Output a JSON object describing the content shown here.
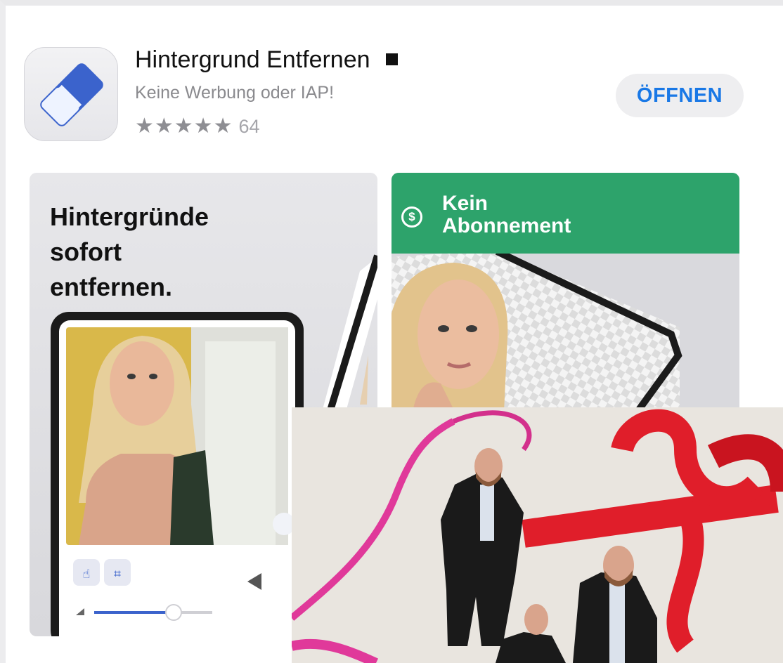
{
  "app": {
    "title": "Hintergrund Entfernen",
    "subtitle": "Keine Werbung oder IAP!",
    "stars": "★★★★★",
    "rating_count": "64",
    "open_label": "ÖFFNEN"
  },
  "screenshots": {
    "card1_heading": "Hintergründe\nsofort\nentfernen.",
    "card2_banner": "Kein\nAbonnement",
    "card2_icon": "no-subscription-icon"
  },
  "colors": {
    "accent": "#1978e6",
    "banner_green": "#2da36b",
    "eraser_blue": "#3b63cc",
    "ribbon_red": "#e01e2a",
    "ribbon_pink": "#e0399a"
  }
}
